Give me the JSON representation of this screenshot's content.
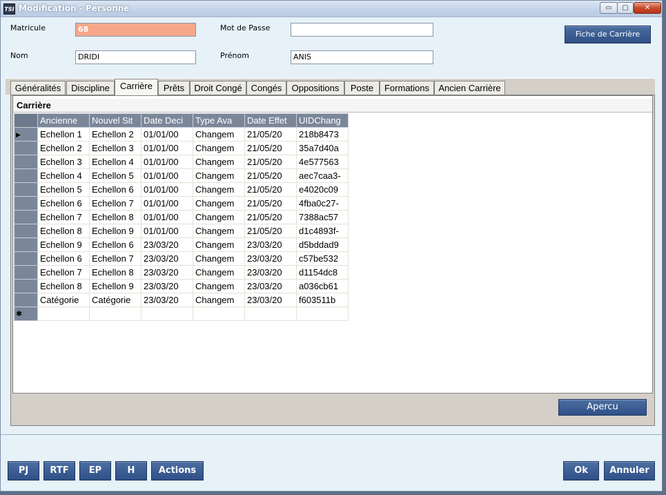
{
  "window": {
    "title": "Modification - Personne",
    "icon": "TSI",
    "controls": {
      "minimize": "▭",
      "maximize": "▢",
      "close": "✕"
    }
  },
  "form": {
    "matricule_label": "Matricule",
    "matricule_value": "68",
    "mot_de_passe_label": "Mot de Passe",
    "mot_de_passe_value": "",
    "nom_label": "Nom",
    "nom_value": "DRIDI",
    "prenom_label": "Prénom",
    "prenom_value": "ANIS",
    "fiche_button": "Fiche de Carrière"
  },
  "tabs": [
    "Généralités",
    "Discipline",
    "Carrière",
    "Prêts",
    "Droit Congé",
    "Congés",
    "Oppositions",
    "Poste",
    "Formations",
    "Ancien Carrière"
  ],
  "active_tab": "Carrière",
  "grid": {
    "title": "Carrière",
    "columns": [
      "Ancienne",
      "Nouvel Sit",
      "Date Deci",
      "Type Ava",
      "Date Effet",
      "UIDChang"
    ],
    "rows": [
      [
        "Echellon 1",
        "Echellon 2",
        "01/01/00",
        "Changem",
        "21/05/20",
        "218b8473"
      ],
      [
        "Echellon 2",
        "Echellon 3",
        "01/01/00",
        "Changem",
        "21/05/20",
        "35a7d40a"
      ],
      [
        "Echellon 3",
        "Echellon 4",
        "01/01/00",
        "Changem",
        "21/05/20",
        "4e577563"
      ],
      [
        "Echellon 4",
        "Echellon 5",
        "01/01/00",
        "Changem",
        "21/05/20",
        "aec7caa3-"
      ],
      [
        "Echellon 5",
        "Echellon 6",
        "01/01/00",
        "Changem",
        "21/05/20",
        "e4020c09"
      ],
      [
        "Echellon 6",
        "Echellon 7",
        "01/01/00",
        "Changem",
        "21/05/20",
        "4fba0c27-"
      ],
      [
        "Echellon 7",
        "Echellon 8",
        "01/01/00",
        "Changem",
        "21/05/20",
        "7388ac57"
      ],
      [
        "Echellon 8",
        "Echellon 9",
        "01/01/00",
        "Changem",
        "21/05/20",
        "d1c4893f-"
      ],
      [
        "Echellon 9",
        "Echellon 6",
        "23/03/20",
        "Changem",
        "23/03/20",
        "d5bddad9"
      ],
      [
        "Echellon 6",
        "Echellon 7",
        "23/03/20",
        "Changem",
        "23/03/20",
        "c57be532"
      ],
      [
        "Echellon 7",
        "Echellon 8",
        "23/03/20",
        "Changem",
        "23/03/20",
        "d1154dc8"
      ],
      [
        "Echellon 8",
        "Echellon 9",
        "23/03/20",
        "Changem",
        "23/03/20",
        "a036cb61"
      ],
      [
        "Catégorie",
        "Catégorie",
        "23/03/20",
        "Changem",
        "23/03/20",
        "f603511b"
      ]
    ],
    "current_row_marker": "▶",
    "new_row_marker": "✱"
  },
  "apercu_button": "Apercu",
  "bottom_buttons": {
    "pj": "PJ",
    "rtf": "RTF",
    "ep": "EP",
    "h": "H",
    "actions": "Actions",
    "ok": "Ok",
    "annuler": "Annuler"
  }
}
